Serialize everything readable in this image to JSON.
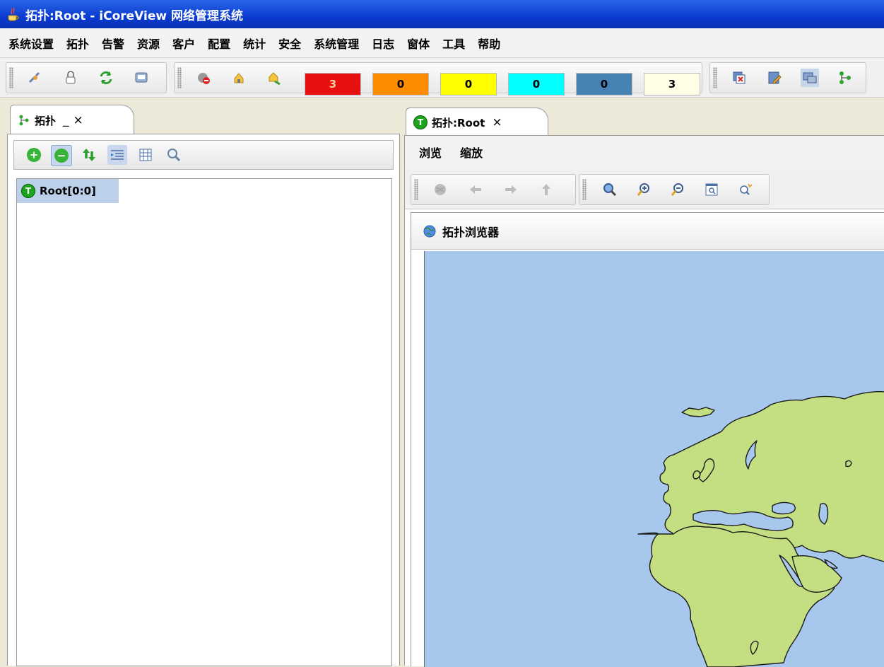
{
  "window": {
    "title": "拓扑:Root - iCoreView 网络管理系统"
  },
  "menu": [
    "系统设置",
    "拓扑",
    "告警",
    "资源",
    "客户",
    "配置",
    "统计",
    "安全",
    "系统管理",
    "日志",
    "窗体",
    "工具",
    "帮助"
  ],
  "alarm_counters": [
    {
      "value": "3",
      "color": "#e80f0f",
      "text_color": "#f5d0a0"
    },
    {
      "value": "0",
      "color": "#ff8c00",
      "text_color": "#000000"
    },
    {
      "value": "0",
      "color": "#ffff00",
      "text_color": "#000000"
    },
    {
      "value": "0",
      "color": "#00ffff",
      "text_color": "#000000"
    },
    {
      "value": "0",
      "color": "#4682b4",
      "text_color": "#000000"
    },
    {
      "value": "3",
      "color": "#fffde6",
      "text_color": "#000000"
    }
  ],
  "left_panel": {
    "tab_label": "拓扑",
    "minimize": "_",
    "close": "×",
    "tree_root": "Root[0:0]"
  },
  "right_panel": {
    "tab_label": "拓扑:Root",
    "close": "×",
    "menus": [
      "浏览",
      "缩放"
    ],
    "browser_title": "拓扑浏览器",
    "map_colors": {
      "ocean": "#a7c8ec",
      "land": "#c3df82"
    }
  },
  "icons": {
    "main_toolbar": [
      "connect-icon",
      "lock-icon",
      "refresh-icon",
      "monitor-icon",
      "alarm-mute-icon",
      "alarm-ack-icon",
      "alarm-clear-icon",
      "window-close-icon",
      "edit-icon",
      "network-icon",
      "topology-icon"
    ],
    "left_toolbar": [
      "add-icon",
      "remove-icon",
      "refresh-icon",
      "indent-icon",
      "table-icon",
      "search-icon"
    ],
    "map_toolbar": [
      "globe-icon",
      "back-icon",
      "forward-icon",
      "up-icon",
      "zoom-fit-icon",
      "zoom-in-icon",
      "zoom-out-icon",
      "zoom-window-icon",
      "zoom-reset-icon"
    ]
  }
}
